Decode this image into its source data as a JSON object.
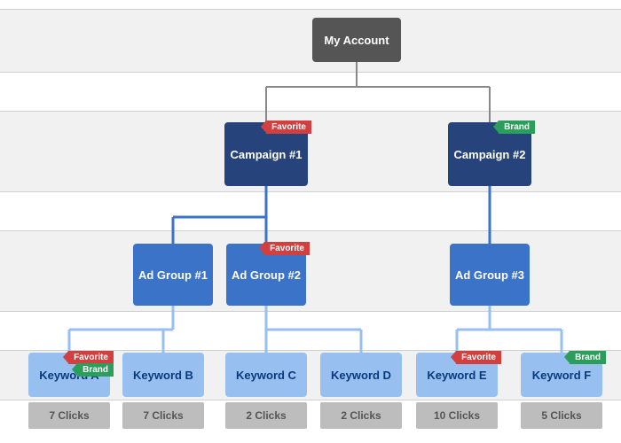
{
  "root": {
    "label": "My Account"
  },
  "labels": {
    "favorite": "Favorite",
    "brand": "Brand"
  },
  "campaigns": [
    {
      "label": "Campaign #1",
      "ribbons": [
        "favorite"
      ]
    },
    {
      "label": "Campaign #2",
      "ribbons": [
        "brand"
      ]
    }
  ],
  "adgroups": [
    {
      "label": "Ad Group #1",
      "campaign": 0
    },
    {
      "label": "Ad Group #2",
      "campaign": 0,
      "ribbons": [
        "favorite"
      ]
    },
    {
      "label": "Ad Group #3",
      "campaign": 1
    }
  ],
  "keywords": [
    {
      "label": "Keyword A",
      "adgroup": 0,
      "ribbons": [
        "favorite",
        "brand"
      ],
      "clicks": "7 Clicks"
    },
    {
      "label": "Keyword B",
      "adgroup": 0,
      "clicks": "7 Clicks"
    },
    {
      "label": "Keyword C",
      "adgroup": 1,
      "clicks": "2 Clicks"
    },
    {
      "label": "Keyword D",
      "adgroup": 1,
      "clicks": "2 Clicks"
    },
    {
      "label": "Keyword E",
      "adgroup": 2,
      "ribbons": [
        "favorite"
      ],
      "clicks": "10 Clicks"
    },
    {
      "label": "Keyword F",
      "adgroup": 2,
      "ribbons": [
        "brand"
      ],
      "clicks": "5 Clicks"
    }
  ],
  "colors": {
    "root": "#555555",
    "campaign": "#26437b",
    "adgroup": "#3b73c9",
    "keyword": "#97bff0",
    "favorite_ribbon": "#d23f3f",
    "brand_ribbon": "#2b9e5b",
    "clicks_box": "#bdbdbd"
  }
}
